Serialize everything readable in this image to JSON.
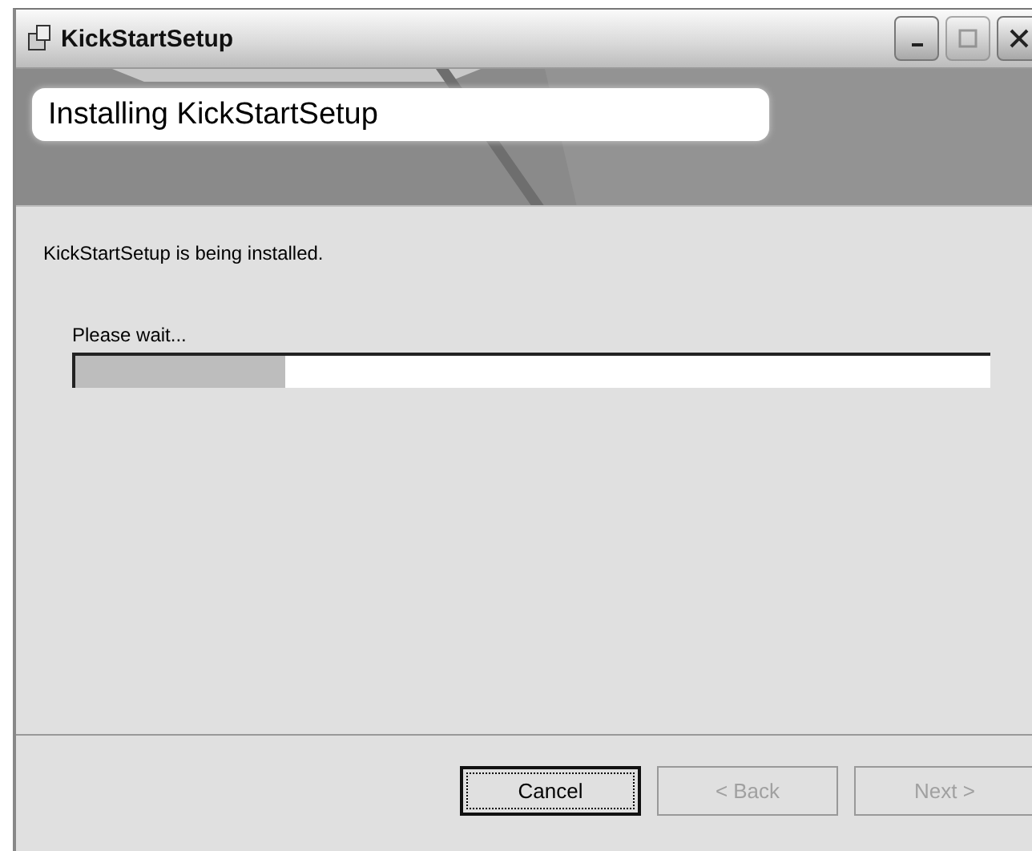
{
  "window": {
    "title": "KickStartSetup"
  },
  "banner": {
    "title": "Installing KickStartSetup"
  },
  "message": "KickStartSetup is being installed.",
  "progress": {
    "label": "Please wait...",
    "level": 0.23
  },
  "buttons": [
    {
      "label": "Cancel",
      "disabled": false,
      "default": true
    },
    {
      "label": "< Back",
      "disabled": true,
      "default": false
    },
    {
      "label": "Next >",
      "disabled": true,
      "default": false
    }
  ]
}
